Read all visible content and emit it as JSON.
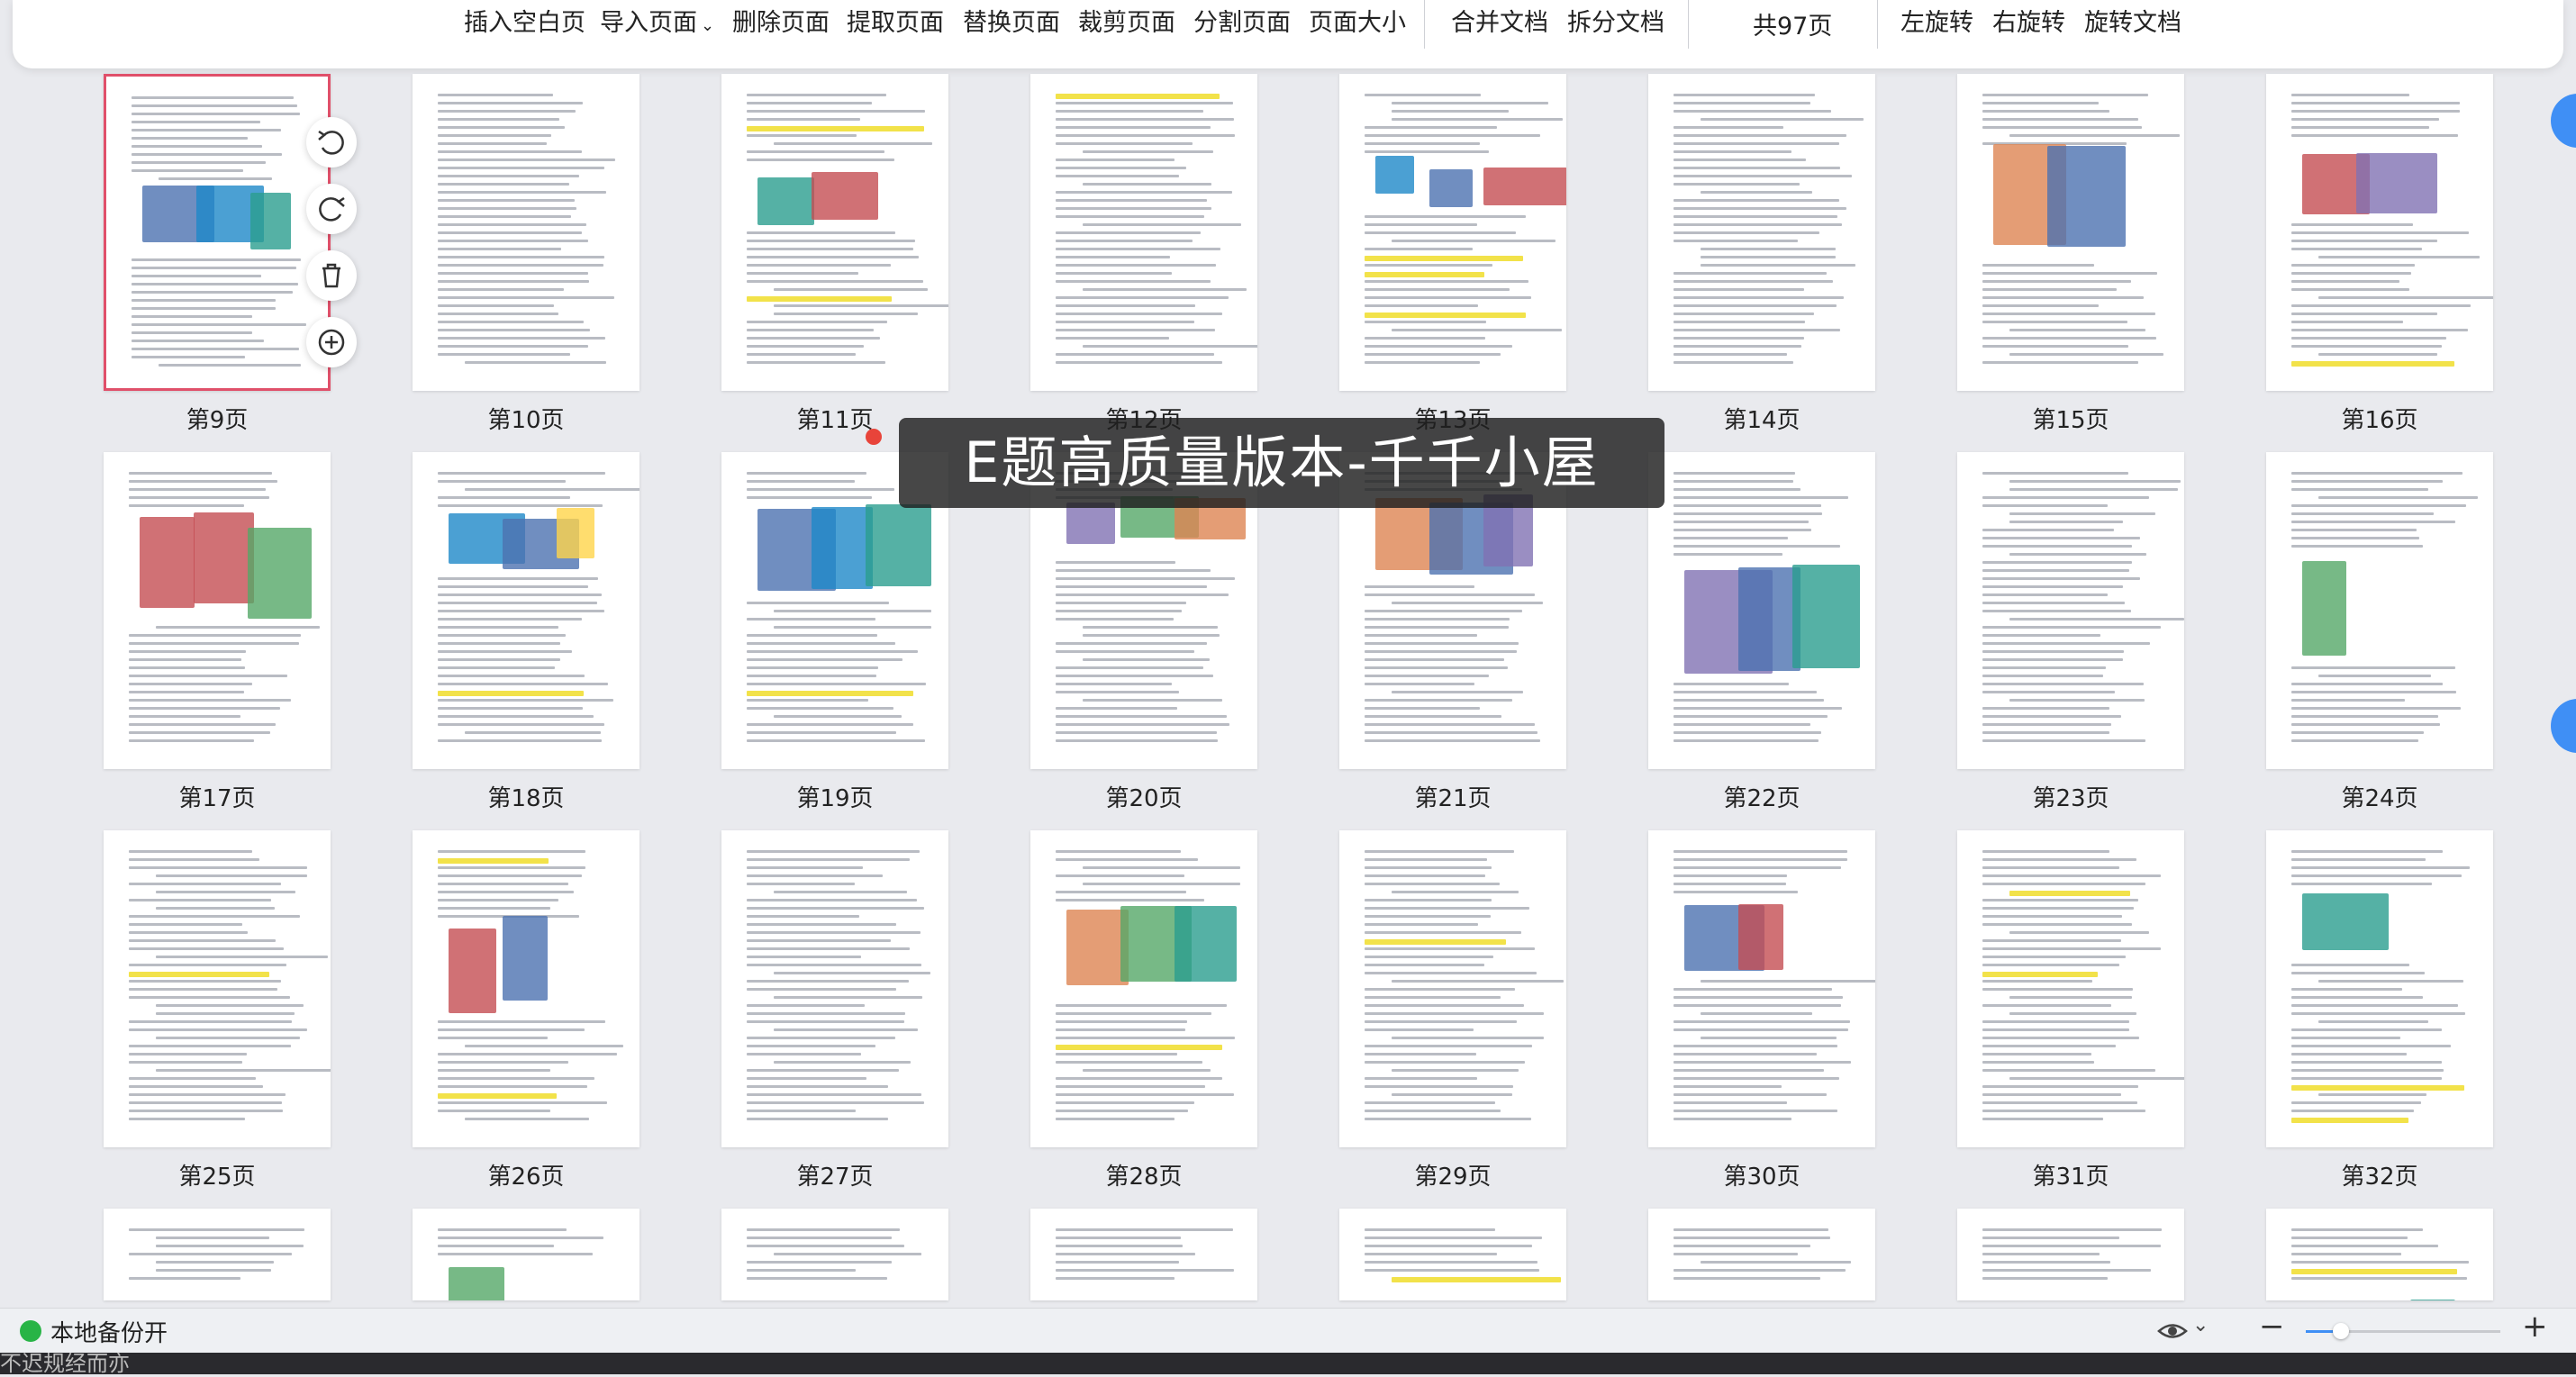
{
  "toolbar": {
    "items": [
      "插入空白页",
      "导入页面",
      "删除页面",
      "提取页面",
      "替换页面",
      "裁剪页面",
      "分割页面",
      "页面大小",
      "合并文档",
      "拆分文档",
      "左旋转",
      "右旋转",
      "旋转文档"
    ],
    "page_count": "共97页"
  },
  "pages": [
    {
      "label": "第9页"
    },
    {
      "label": "第10页"
    },
    {
      "label": "第11页"
    },
    {
      "label": "第12页"
    },
    {
      "label": "第13页"
    },
    {
      "label": "第14页"
    },
    {
      "label": "第15页"
    },
    {
      "label": "第16页"
    },
    {
      "label": "第17页"
    },
    {
      "label": "第18页"
    },
    {
      "label": "第19页"
    },
    {
      "label": "第20页"
    },
    {
      "label": "第21页"
    },
    {
      "label": "第22页"
    },
    {
      "label": "第23页"
    },
    {
      "label": "第24页"
    },
    {
      "label": "第25页"
    },
    {
      "label": "第26页"
    },
    {
      "label": "第27页"
    },
    {
      "label": "第28页"
    },
    {
      "label": "第29页"
    },
    {
      "label": "第30页"
    },
    {
      "label": "第31页"
    },
    {
      "label": "第32页"
    },
    {
      "label": ""
    },
    {
      "label": ""
    },
    {
      "label": ""
    },
    {
      "label": ""
    },
    {
      "label": ""
    },
    {
      "label": ""
    },
    {
      "label": ""
    },
    {
      "label": ""
    }
  ],
  "selected_page": "第9页",
  "watermark": "E题高质量版本-千千小屋",
  "status": {
    "backup": "本地备份开",
    "dock_text": "不迟规经而亦"
  },
  "colors": {
    "selected_border": "#e0506a",
    "status_ok": "#28b446",
    "accent_blue": "#3f8ff5"
  }
}
